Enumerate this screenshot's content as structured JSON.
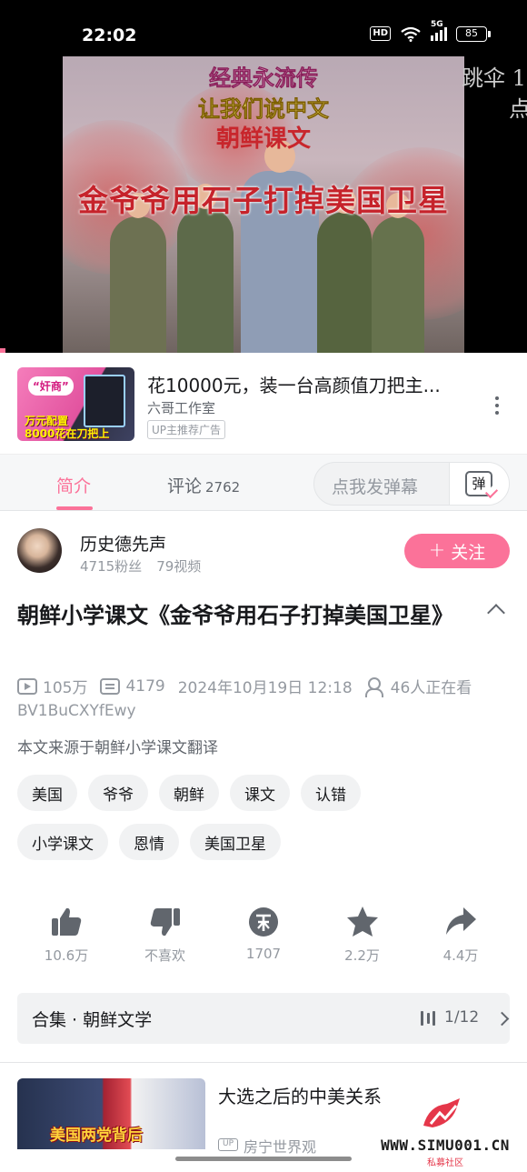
{
  "status_bar": {
    "time": "22:02",
    "hd": "HD",
    "network": "5G",
    "battery": "85"
  },
  "video": {
    "title_line1": "经典永流传",
    "title_line2": "让我们说中文",
    "title_line3": "朝鲜课文",
    "overlay": "金爷爷用石子打掉美国卫星",
    "danmaku_right": "跳伞 1",
    "danmaku_right2": "点"
  },
  "ad": {
    "thumb_label": "“奸商”",
    "thumb_line1": "万元配置",
    "thumb_line2": "8000花在刀把上",
    "title": "花10000元，装一台高颜值刀把主...",
    "author": "六哥工作室",
    "tag": "UP主推荐广告"
  },
  "tabs": {
    "intro": "简介",
    "comments": "评论",
    "comments_count": "2762",
    "danmaku_placeholder": "点我发弹幕",
    "danmaku_button": "弹"
  },
  "uploader": {
    "name": "历史德先声",
    "fans": "4715粉丝",
    "videos": "79视频",
    "follow": "关注",
    "follow_plus": "+"
  },
  "video_info": {
    "title": "朝鲜小学课文《金爷爷用石子打掉美国卫星》",
    "views": "105万",
    "danmaku_count": "4179",
    "date": "2024年10月19日 12:18",
    "watching": "46人正在看",
    "bvid": "BV1BuCXYfEwy",
    "description": "本文来源于朝鲜小学课文翻译"
  },
  "tags": [
    [
      "美国",
      "爷爷",
      "朝鲜",
      "课文",
      "认错"
    ],
    [
      "小学课文",
      "恩情",
      "美国卫星"
    ]
  ],
  "actions": {
    "like": "10.6万",
    "dislike": "不喜欢",
    "coin": "1707",
    "favorite": "2.2万",
    "share": "4.4万"
  },
  "collection": {
    "title": "合集 · 朝鲜文学",
    "progress": "1/12"
  },
  "recommendation": {
    "thumb_text": "美国两党背后",
    "title": "大选之后的中美关系",
    "up_icon": "UP",
    "author": "房宁世界观"
  },
  "watermark": {
    "text": "WWW.SIMU001.CN",
    "sub": "私募社区"
  },
  "colors": {
    "accent": "#fb7299",
    "text": "#18191c",
    "muted": "#9499a0"
  },
  "icons": {
    "like": "thumb-up-icon",
    "dislike": "thumb-down-icon",
    "coin": "coin-icon",
    "favorite": "star-icon",
    "share": "share-icon"
  }
}
